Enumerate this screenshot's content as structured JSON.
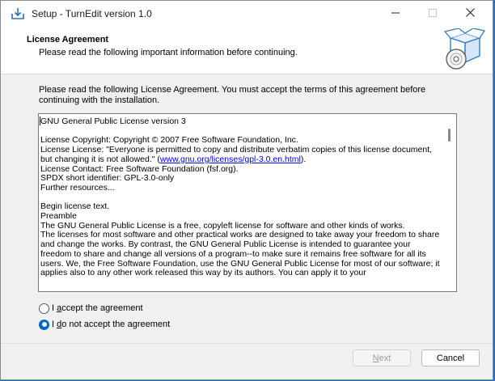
{
  "window": {
    "title": "Setup - TurnEdit version 1.0"
  },
  "header": {
    "title": "License Agreement",
    "subtitle": "Please read the following important information before continuing."
  },
  "intro": "Please read the following License Agreement. You must accept the terms of this agreement before continuing with the installation.",
  "license": {
    "l1": "GNU General Public License version 3",
    "l2": "License Copyright: Copyright © 2007 Free Software Foundation, Inc.",
    "l3a": "License License: \"Everyone is permitted to copy and distribute verbatim copies of this license document, but changing it is not allowed.\" (",
    "l3link": "www.gnu.org/licenses/gpl-3.0.en.html",
    "l3b": ").",
    "l4": "License Contact: Free Software Foundation (fsf.org).",
    "l5": "SPDX short identifier: GPL-3.0-only",
    "l6": "Further resources...",
    "l7": "Begin license text.",
    "l8": "Preamble",
    "l9": "The GNU General Public License is a free, copyleft license for software and other kinds of works.",
    "l10": "The licenses for most software and other practical works are designed to take away your freedom to share and change the works. By contrast, the GNU General Public License is intended to guarantee your freedom to share and change all versions of a program--to make sure it remains free software for all its users. We, the Free Software Foundation, use the GNU General Public License for most of our software; it applies also to any other work released this way by its authors. You can apply it to your"
  },
  "options": {
    "accept": {
      "prefix": "I ",
      "key": "a",
      "rest": "ccept the agreement",
      "selected": false
    },
    "decline": {
      "prefix": "I ",
      "key": "d",
      "rest": "o not accept the agreement",
      "selected": true
    }
  },
  "buttons": {
    "next": {
      "prefix": "",
      "key": "N",
      "rest": "ext",
      "enabled": false
    },
    "cancel": "Cancel"
  },
  "colors": {
    "accent": "#0067c0",
    "link": "#0000ee",
    "disabled_text": "#9d9d9d"
  },
  "icons": [
    "setup-app-icon",
    "minimize-icon",
    "maximize-icon",
    "close-icon",
    "setup-box-disc-icon"
  ]
}
